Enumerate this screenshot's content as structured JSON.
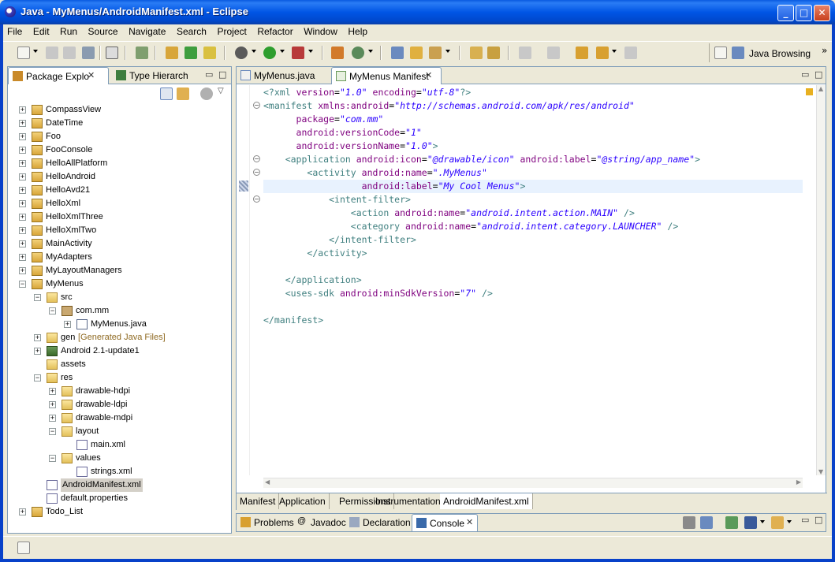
{
  "window": {
    "title": "Java - MyMenus/AndroidManifest.xml - Eclipse"
  },
  "menu": [
    "File",
    "Edit",
    "Run",
    "Source",
    "Navigate",
    "Search",
    "Project",
    "Refactor",
    "Window",
    "Help"
  ],
  "toolbar": {
    "perspective_label": "Java Browsing"
  },
  "package_explorer": {
    "tabs": [
      {
        "label": "Package Explo"
      },
      {
        "label": "Type Hierarch"
      }
    ],
    "tree": [
      {
        "label": "CompassView",
        "depth": 0,
        "expanded": false
      },
      {
        "label": "DateTime",
        "depth": 0,
        "expanded": false
      },
      {
        "label": "Foo",
        "depth": 0,
        "expanded": false
      },
      {
        "label": "FooConsole",
        "depth": 0,
        "expanded": false
      },
      {
        "label": "HelloAllPlatform",
        "depth": 0,
        "expanded": false
      },
      {
        "label": "HelloAndroid",
        "depth": 0,
        "expanded": false
      },
      {
        "label": "HelloAvd21",
        "depth": 0,
        "expanded": false
      },
      {
        "label": "HelloXml",
        "depth": 0,
        "expanded": false
      },
      {
        "label": "HelloXmlThree",
        "depth": 0,
        "expanded": false
      },
      {
        "label": "HelloXmlTwo",
        "depth": 0,
        "expanded": false
      },
      {
        "label": "MainActivity",
        "depth": 0,
        "expanded": false
      },
      {
        "label": "MyAdapters",
        "depth": 0,
        "expanded": false
      },
      {
        "label": "MyLayoutManagers",
        "depth": 0,
        "expanded": false
      },
      {
        "label": "MyMenus",
        "depth": 0,
        "expanded": true
      },
      {
        "label": "src",
        "depth": 1,
        "expanded": true
      },
      {
        "label": "com.mm",
        "depth": 2,
        "expanded": true
      },
      {
        "label": "MyMenus.java",
        "depth": 3,
        "expanded": false
      },
      {
        "label": "gen",
        "decoration": "[Generated Java Files]",
        "depth": 1,
        "expanded": false
      },
      {
        "label": "Android 2.1-update1",
        "depth": 1,
        "expanded": false
      },
      {
        "label": "assets",
        "depth": 1,
        "expanded": null
      },
      {
        "label": "res",
        "depth": 1,
        "expanded": true
      },
      {
        "label": "drawable-hdpi",
        "depth": 2,
        "expanded": false
      },
      {
        "label": "drawable-ldpi",
        "depth": 2,
        "expanded": false
      },
      {
        "label": "drawable-mdpi",
        "depth": 2,
        "expanded": false
      },
      {
        "label": "layout",
        "depth": 2,
        "expanded": true
      },
      {
        "label": "main.xml",
        "depth": 3,
        "expanded": null
      },
      {
        "label": "values",
        "depth": 2,
        "expanded": true
      },
      {
        "label": "strings.xml",
        "depth": 3,
        "expanded": null
      },
      {
        "label": "AndroidManifest.xml",
        "depth": 1,
        "expanded": null,
        "selected": true
      },
      {
        "label": "default.properties",
        "depth": 1,
        "expanded": null
      },
      {
        "label": "Todo_List",
        "depth": 0,
        "expanded": false
      }
    ]
  },
  "editor": {
    "tabs": [
      {
        "label": "MyMenus.java"
      },
      {
        "label": "MyMenus Manifest"
      }
    ],
    "code": [
      "<?xml version=\"1.0\" encoding=\"utf-8\"?>",
      "<manifest xmlns:android=\"http://schemas.android.com/apk/res/android\"",
      "      package=\"com.mm\"",
      "      android:versionCode=\"1\"",
      "      android:versionName=\"1.0\">",
      "    <application android:icon=\"@drawable/icon\" android:label=\"@string/app_name\">",
      "        <activity android:name=\".MyMenus\"",
      "                  android:label=\"My Cool Menus\">",
      "            <intent-filter>",
      "                <action android:name=\"android.intent.action.MAIN\" />",
      "                <category android:name=\"android.intent.category.LAUNCHER\" />",
      "            </intent-filter>",
      "        </activity>",
      "",
      "    </application>",
      "    <uses-sdk android:minSdkVersion=\"7\" />",
      "",
      "</manifest>"
    ],
    "bottom_tabs": [
      "Manifest",
      "Application",
      "Permissions",
      "Instrumentation",
      "AndroidManifest.xml"
    ]
  },
  "bottom_views": {
    "tabs": [
      {
        "label": "Problems"
      },
      {
        "label": "Javadoc"
      },
      {
        "label": "Declaration"
      },
      {
        "label": "Console"
      }
    ]
  },
  "colors": {
    "title_bar": "#0055e5",
    "xml_tag": "#3f7f7f",
    "xml_attr": "#7f007f",
    "xml_value": "#2a00ff"
  }
}
